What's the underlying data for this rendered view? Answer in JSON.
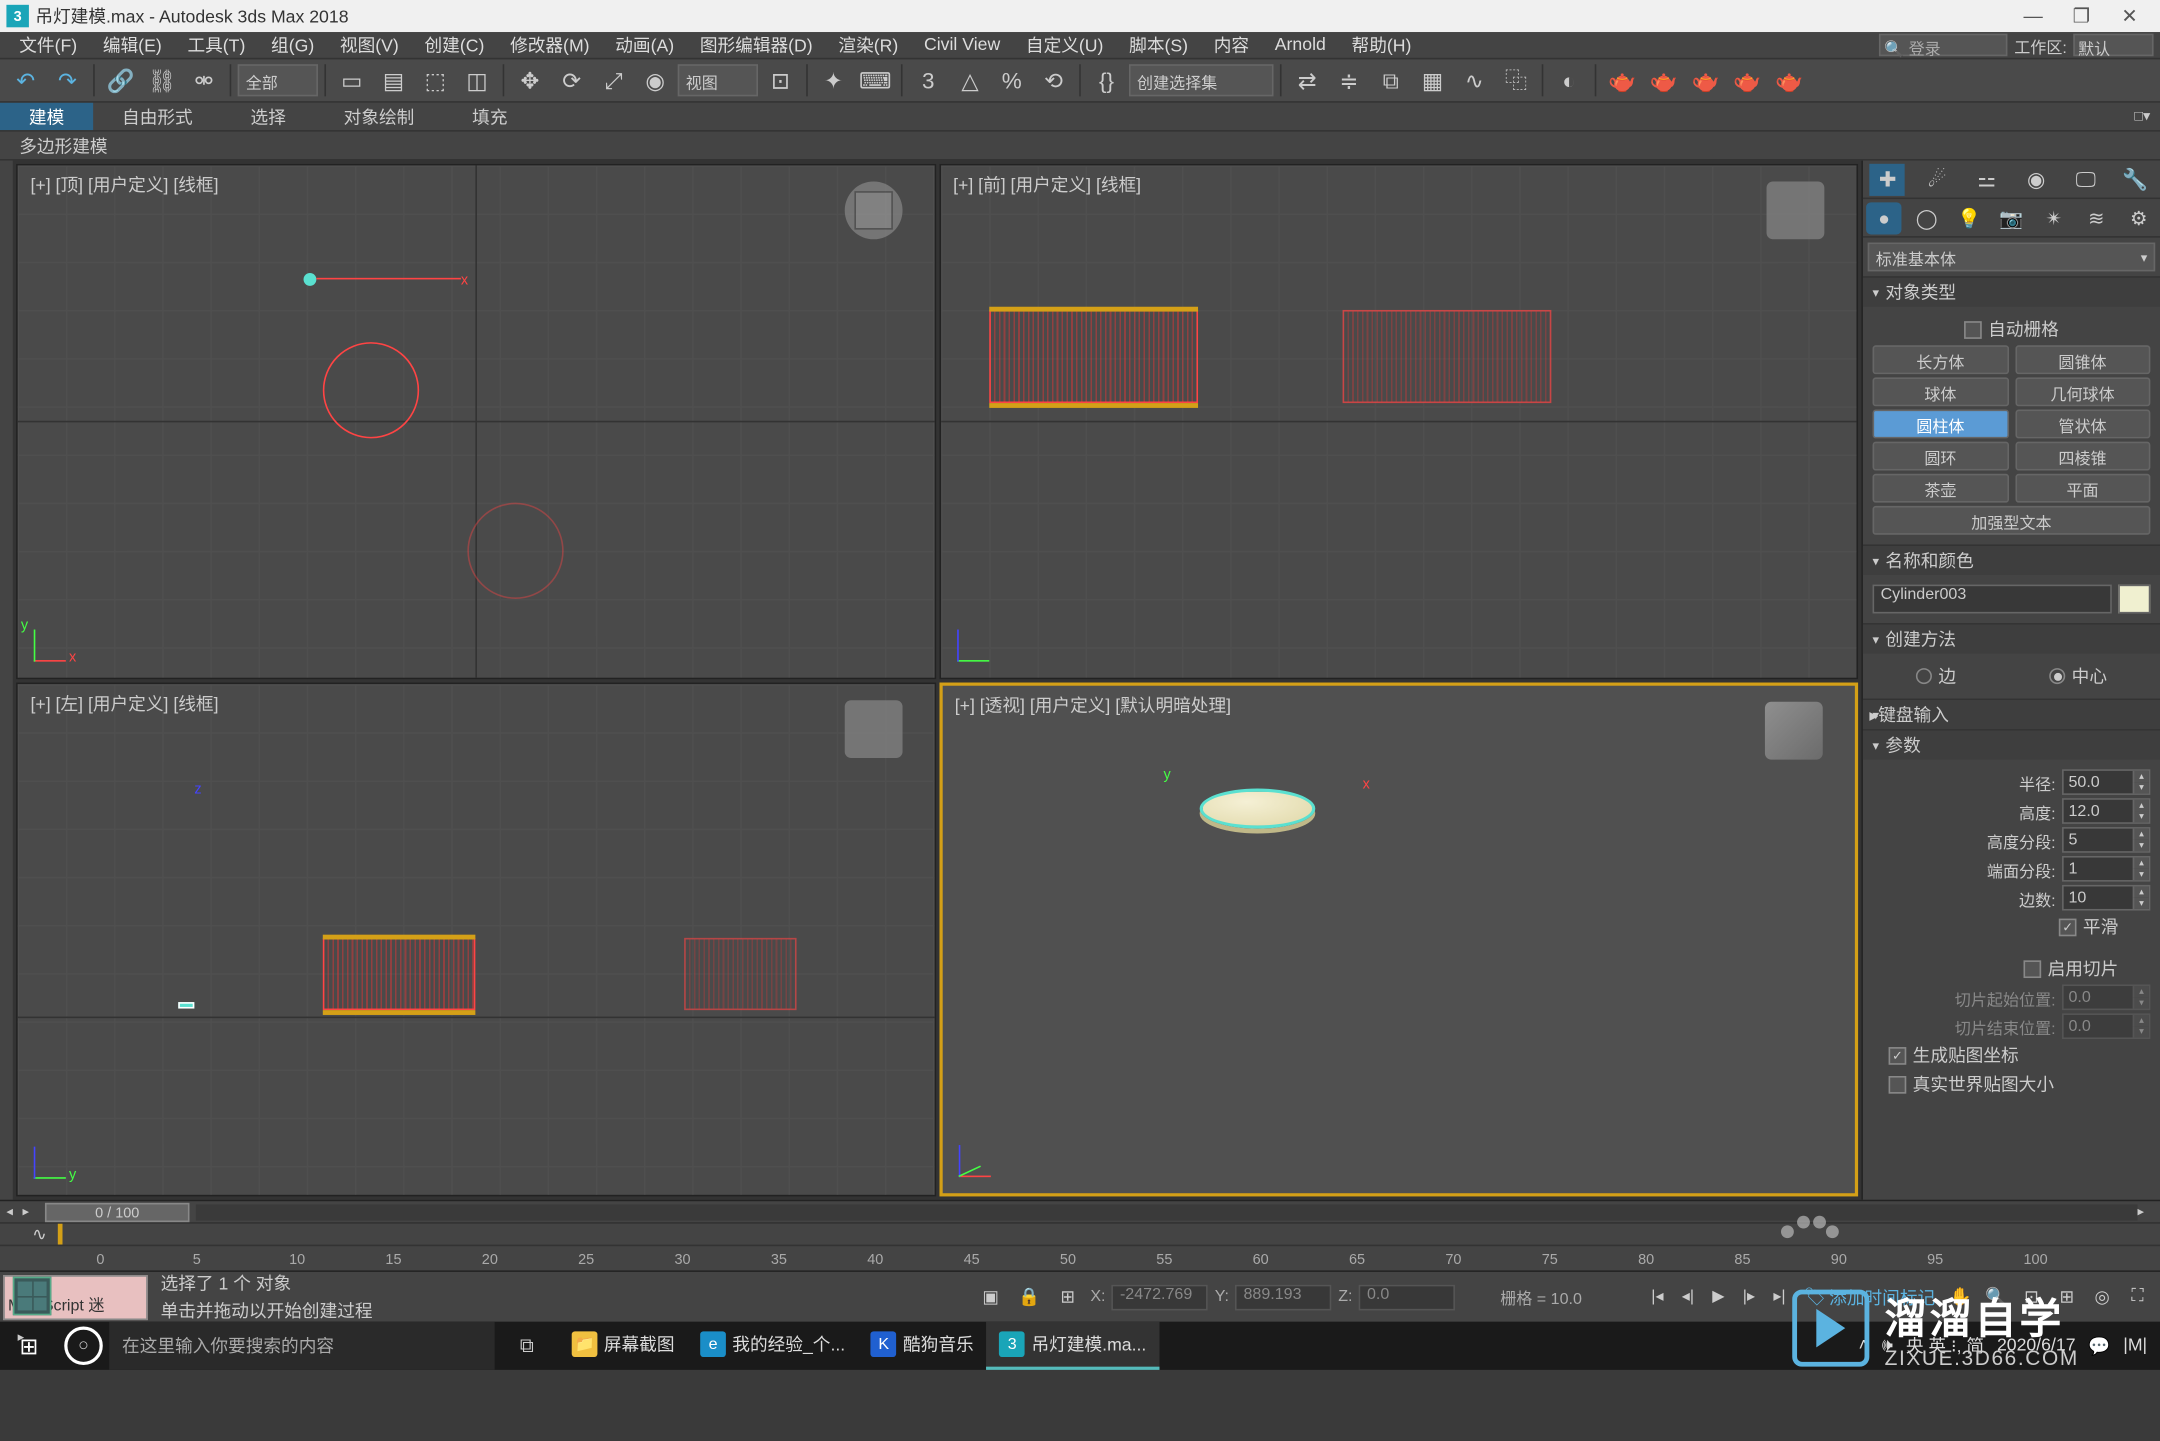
{
  "title": "吊灯建模.max - Autodesk 3ds Max 2018",
  "window": {
    "min": "—",
    "max": "❐",
    "close": "✕"
  },
  "menu": [
    "文件(F)",
    "编辑(E)",
    "工具(T)",
    "组(G)",
    "视图(V)",
    "创建(C)",
    "修改器(M)",
    "动画(A)",
    "图形编辑器(D)",
    "渲染(R)",
    "Civil View",
    "自定义(U)",
    "脚本(S)",
    "内容",
    "Arnold",
    "帮助(H)"
  ],
  "menu_search_ph": "🔍 登录",
  "workspace_label": "工作区:",
  "workspace_value": "默认",
  "toolbar_dd1": "全部",
  "toolbar_dd2": "视图",
  "toolbar_dd3": "创建选择集",
  "ribbon_tabs": [
    "建模",
    "自由形式",
    "选择",
    "对象绘制",
    "填充"
  ],
  "subribbon": "多边形建模",
  "viewports": {
    "top": "[+] [顶]  [用户定义]  [线框]",
    "front": "[+] [前]  [用户定义]  [线框]",
    "left": "[+] [左]  [用户定义]  [线框]",
    "persp": "[+] [透视]  [用户定义]  [默认明暗处理]"
  },
  "cmdpanel": {
    "dd": "标准基本体",
    "roll_objtype": "对象类型",
    "autogrid": "自动栅格",
    "prims": {
      "box": "长方体",
      "cone": "圆锥体",
      "sphere": "球体",
      "geosphere": "几何球体",
      "cylinder": "圆柱体",
      "tube": "管状体",
      "torus": "圆环",
      "pyramid": "四棱锥",
      "teapot": "茶壶",
      "plane": "平面",
      "textplus": "加强型文本"
    },
    "roll_name": "名称和颜色",
    "objname": "Cylinder003",
    "roll_create": "创建方法",
    "edge": "边",
    "center": "中心",
    "roll_kb": "键盘输入",
    "roll_params": "参数",
    "radius_l": "半径:",
    "radius_v": "50.0",
    "height_l": "高度:",
    "height_v": "12.0",
    "hseg_l": "高度分段:",
    "hseg_v": "5",
    "cseg_l": "端面分段:",
    "cseg_v": "1",
    "sides_l": "边数:",
    "sides_v": "10",
    "smooth": "平滑",
    "sliceon": "启用切片",
    "slicefrom_l": "切片起始位置:",
    "slicefrom_v": "0.0",
    "sliceto_l": "切片结束位置:",
    "sliceto_v": "0.0",
    "genuv": "生成贴图坐标",
    "realworld": "真实世界贴图大小"
  },
  "timeline": {
    "handle": "0 / 100",
    "ticks": [
      "0",
      "5",
      "10",
      "15",
      "20",
      "25",
      "30",
      "35",
      "40",
      "45",
      "50",
      "55",
      "60",
      "65",
      "70",
      "75",
      "80",
      "85",
      "90",
      "95",
      "100"
    ]
  },
  "status": {
    "script": "MAXScript 迷",
    "prompt1": "选择了 1 个 对象",
    "prompt2": "单击并拖动以开始创建过程",
    "x_l": "X:",
    "x_v": "-2472.769",
    "y_l": "Y:",
    "y_v": "889.193",
    "z_l": "Z:",
    "z_v": "0.0",
    "grid": "栅格 = 10.0",
    "addtag": "添加时间标记"
  },
  "taskbar": {
    "search": "在这里输入你要搜索的内容",
    "apps": [
      {
        "ico": "📁",
        "label": "屏幕截图",
        "color": "#f0c040"
      },
      {
        "ico": "e",
        "label": "我的经验_个...",
        "color": "#1a8ec8"
      },
      {
        "ico": "K",
        "label": "酷狗音乐",
        "color": "#2060d0"
      },
      {
        "ico": "3",
        "label": "吊灯建模.ma...",
        "color": "#1aa5b8"
      }
    ],
    "tray_ime": "央 英 ⁝, 简",
    "tray_date": "2020/6/17"
  },
  "watermark": {
    "t1": "溜溜自学",
    "t2": "ZIXUE.3D66.COM"
  }
}
